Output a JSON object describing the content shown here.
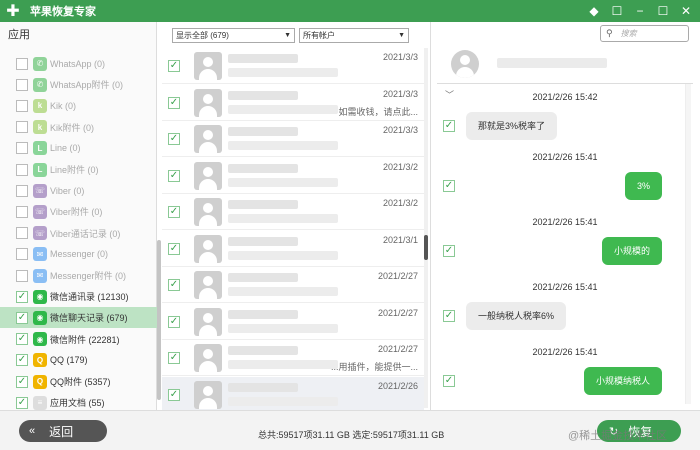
{
  "app": {
    "title": "苹果恢复专家",
    "accent": "#3d9e52",
    "selected_bg": "#bde3c4"
  },
  "window_controls": [
    "diamond-icon",
    "chat-icon",
    "minimize-icon",
    "maximize-icon",
    "close-icon"
  ],
  "sidebar": {
    "header": "应用",
    "items": [
      {
        "label": "WhatsApp (0)",
        "icon": "whatsapp-icon",
        "color": "#3ab54a",
        "checked": false,
        "enabled": false
      },
      {
        "label": "WhatsApp附件 (0)",
        "icon": "whatsapp-icon",
        "color": "#3ab54a",
        "checked": false,
        "enabled": false
      },
      {
        "label": "Kik (0)",
        "icon": "kik-icon",
        "color": "#8cc63f",
        "checked": false,
        "enabled": false
      },
      {
        "label": "Kik附件 (0)",
        "icon": "kik-icon",
        "color": "#8cc63f",
        "checked": false,
        "enabled": false
      },
      {
        "label": "Line (0)",
        "icon": "line-icon",
        "color": "#2fb84a",
        "checked": false,
        "enabled": false
      },
      {
        "label": "Line附件 (0)",
        "icon": "line-icon",
        "color": "#2fb84a",
        "checked": false,
        "enabled": false
      },
      {
        "label": "Viber (0)",
        "icon": "viber-icon",
        "color": "#7b55a4",
        "checked": false,
        "enabled": false
      },
      {
        "label": "Viber附件 (0)",
        "icon": "viber-icon",
        "color": "#7b55a4",
        "checked": false,
        "enabled": false
      },
      {
        "label": "Viber通话记录 (0)",
        "icon": "viber-icon",
        "color": "#7b55a4",
        "checked": false,
        "enabled": false
      },
      {
        "label": "Messenger (0)",
        "icon": "messenger-icon",
        "color": "#2f8ef0",
        "checked": false,
        "enabled": false
      },
      {
        "label": "Messenger附件 (0)",
        "icon": "messenger-icon",
        "color": "#2f8ef0",
        "checked": false,
        "enabled": false
      },
      {
        "label": "微信通讯录 (12130)",
        "icon": "wechat-icon",
        "color": "#2fb84a",
        "checked": true,
        "enabled": true
      },
      {
        "label": "微信聊天记录 (679)",
        "icon": "wechat-icon",
        "color": "#2fb84a",
        "checked": true,
        "enabled": true,
        "selected": true
      },
      {
        "label": "微信附件 (22281)",
        "icon": "wechat-icon",
        "color": "#2fb84a",
        "checked": true,
        "enabled": true
      },
      {
        "label": "QQ (179)",
        "icon": "qq-icon",
        "color": "#f0b400",
        "checked": true,
        "enabled": true
      },
      {
        "label": "QQ附件 (5357)",
        "icon": "qq-icon",
        "color": "#f0b400",
        "checked": true,
        "enabled": true
      },
      {
        "label": "应用文档 (55)",
        "icon": "document-icon",
        "color": "#dddddd",
        "checked": true,
        "enabled": true
      }
    ]
  },
  "filters": {
    "show": "显示全部 (679)",
    "account": "所有帐户"
  },
  "search": {
    "placeholder": "搜索"
  },
  "conversations": [
    {
      "date": "2021/3/3",
      "snippet": "",
      "highlight": false
    },
    {
      "date": "2021/3/3",
      "snippet": "如需收钱，请点此...",
      "highlight": false
    },
    {
      "date": "2021/3/3",
      "snippet": "",
      "highlight": false
    },
    {
      "date": "2021/3/2",
      "snippet": "",
      "highlight": false
    },
    {
      "date": "2021/3/2",
      "snippet": "",
      "highlight": false
    },
    {
      "date": "2021/3/1",
      "snippet": "",
      "highlight": false
    },
    {
      "date": "2021/2/27",
      "snippet": "",
      "highlight": false
    },
    {
      "date": "2021/2/27",
      "snippet": "",
      "highlight": false
    },
    {
      "date": "2021/2/27",
      "snippet": "...用插件，能提供一...",
      "highlight": false
    },
    {
      "date": "2021/2/26",
      "snippet": "",
      "highlight": true
    }
  ],
  "chat": {
    "messages": [
      {
        "time": "2021/2/26 15:42",
        "text": "那就是3%税率了",
        "dir": "in"
      },
      {
        "time": "2021/2/26 15:41",
        "text": "3%",
        "dir": "out"
      },
      {
        "time": "2021/2/26 15:41",
        "text": "小规模的",
        "dir": "out"
      },
      {
        "time": "2021/2/26 15:41",
        "text": "一般纳税人税率6%",
        "dir": "in"
      },
      {
        "time": "2021/2/26 15:41",
        "text": "小规模纳税人",
        "dir": "out"
      }
    ]
  },
  "bottom": {
    "back_label": "返回",
    "status": "总共:59517项31.11 GB 选定:59517项31.11 GB",
    "restore_label": "恢复"
  },
  "watermark": "@稀土掘金技术社区"
}
